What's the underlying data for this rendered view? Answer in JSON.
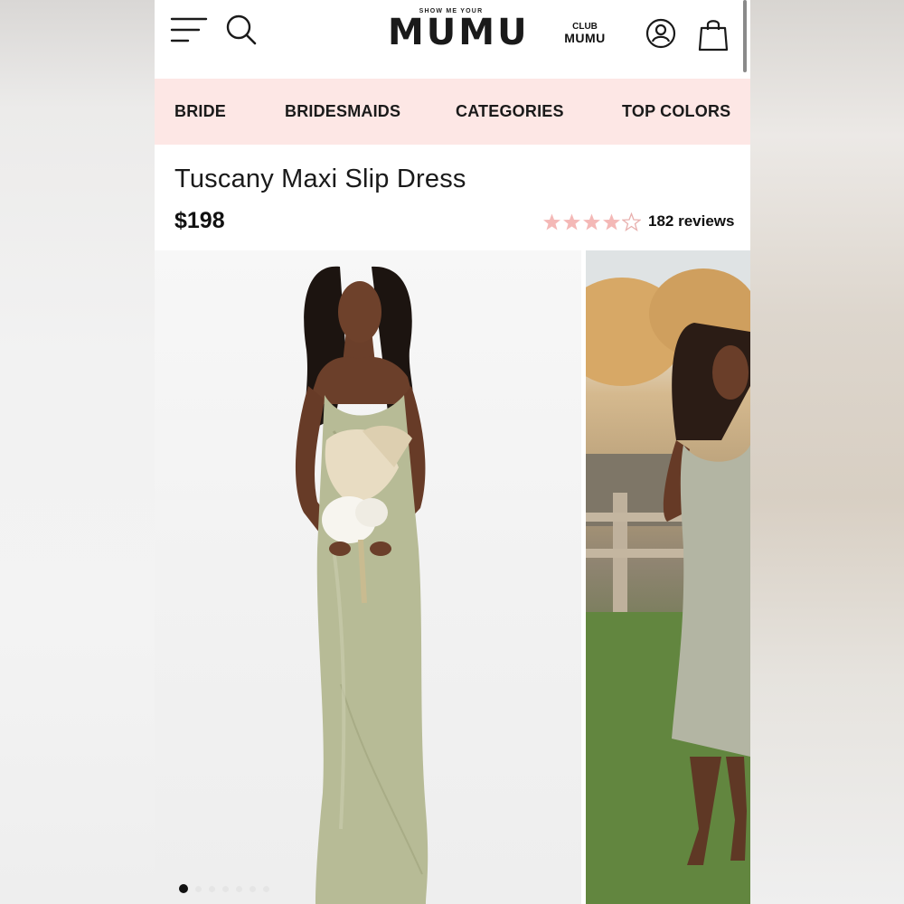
{
  "brand": {
    "tagline": "SHOW ME YOUR",
    "name": "MUMU"
  },
  "club": {
    "line1": "CLUB",
    "line2": "MUMU"
  },
  "nav": {
    "items": [
      {
        "label": "BRIDE"
      },
      {
        "label": "BRIDESMAIDS"
      },
      {
        "label": "CATEGORIES"
      },
      {
        "label": "TOP COLORS"
      }
    ]
  },
  "product": {
    "title": "Tuscany Maxi Slip Dress",
    "price": "$198",
    "rating": 4,
    "rating_max": 5,
    "reviews_label": "182 reviews"
  },
  "gallery": {
    "image_count": 7,
    "active_index": 0
  },
  "colors": {
    "nav_bg": "#fde7e5",
    "star_filled": "#f4b8b6",
    "star_empty": "#e8b0ae",
    "dress": "#b9bd98"
  }
}
